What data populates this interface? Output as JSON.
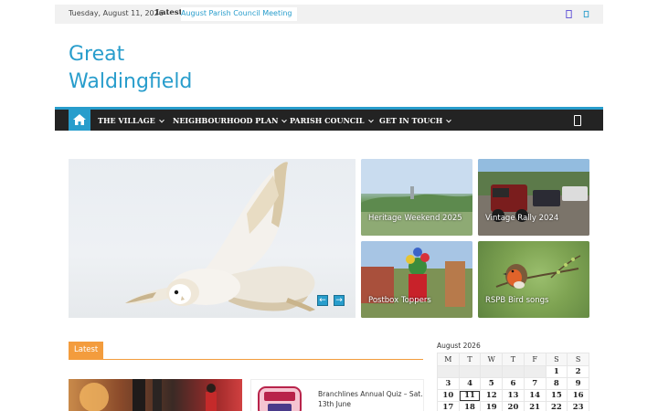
{
  "topbar": {
    "date": "Tuesday, August 11, 2026",
    "latest_label": "Latest:",
    "latest_headline": "August Parish Council Meeting"
  },
  "site": {
    "title": "Great Waldingfield"
  },
  "nav": {
    "items": [
      {
        "label": "THE VILLAGE"
      },
      {
        "label": "NEIGHBOURHOOD PLAN"
      },
      {
        "label": "PARISH COUNCIL"
      },
      {
        "label": "GET IN TOUCH"
      }
    ]
  },
  "slider": {
    "prev_label": "←",
    "next_label": "→"
  },
  "featured_tiles": [
    {
      "caption": "Heritage Weekend 2025"
    },
    {
      "caption": "Vintage Rally 2024"
    },
    {
      "caption": "Postbox Toppers"
    },
    {
      "caption": "RSPB Bird songs"
    }
  ],
  "latest": {
    "heading": "Latest",
    "posts": [
      {
        "title": ""
      },
      {
        "title": "Branchlines Annual Quiz – Sat. 13th June"
      }
    ]
  },
  "calendar": {
    "caption": "August 2026",
    "weekdays": [
      "M",
      "T",
      "W",
      "T",
      "F",
      "S",
      "S"
    ],
    "weeks": [
      [
        "",
        "",
        "",
        "",
        "",
        "1",
        "2"
      ],
      [
        "3",
        "4",
        "5",
        "6",
        "7",
        "8",
        "9"
      ],
      [
        "10",
        "11",
        "12",
        "13",
        "14",
        "15",
        "16"
      ],
      [
        "17",
        "18",
        "19",
        "20",
        "21",
        "22",
        "23"
      ]
    ],
    "today": "11"
  },
  "colors": {
    "accent": "#289dcc",
    "latest_orange": "#f39c3d",
    "nav_bg": "#232323"
  },
  "icons": {
    "home": "home-icon",
    "facebook": "facebook-icon",
    "twitter": "twitter-icon",
    "mobile": "mobile-menu-icon"
  }
}
